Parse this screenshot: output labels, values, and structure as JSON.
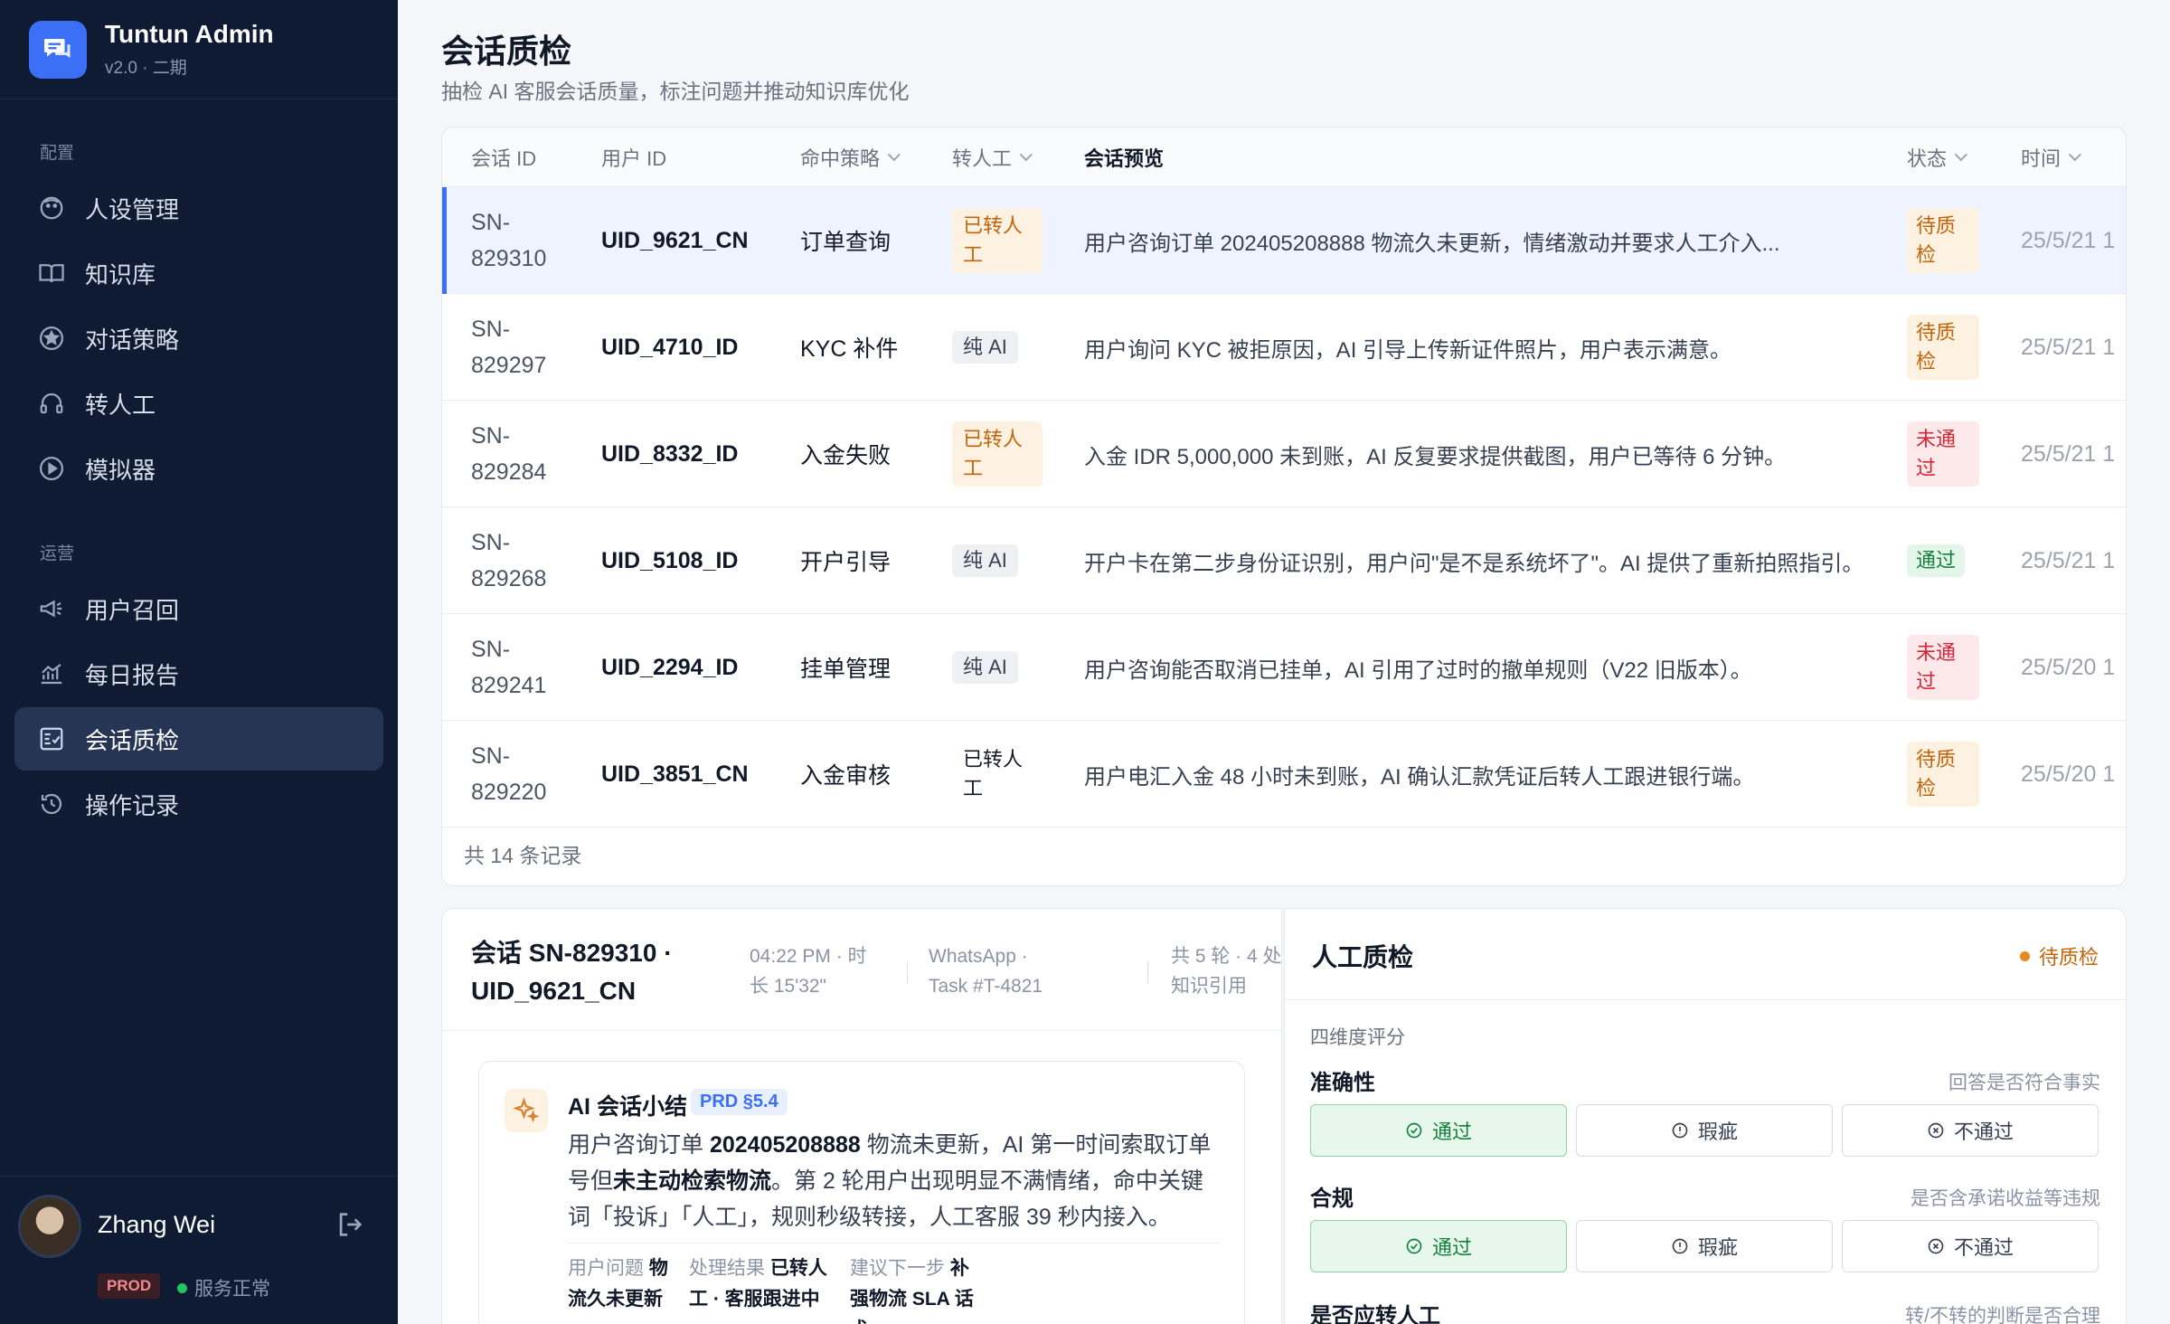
{
  "app": {
    "title": "Tuntun Admin",
    "version": "v2.0 · 二期"
  },
  "sidebar": {
    "section_config": "配置",
    "section_ops": "运营",
    "items": [
      {
        "label": "人设管理",
        "icon": "persona-icon"
      },
      {
        "label": "知识库",
        "icon": "book-icon"
      },
      {
        "label": "对话策略",
        "icon": "star-icon"
      },
      {
        "label": "转人工",
        "icon": "headset-icon"
      },
      {
        "label": "模拟器",
        "icon": "play-icon"
      },
      {
        "label": "用户召回",
        "icon": "megaphone-icon"
      },
      {
        "label": "每日报告",
        "icon": "chart-icon"
      },
      {
        "label": "会话质检",
        "icon": "checklist-icon",
        "active": true
      },
      {
        "label": "操作记录",
        "icon": "history-icon"
      }
    ]
  },
  "user": {
    "name": "Zhang Wei",
    "env": "PROD",
    "status": "服务正常"
  },
  "page": {
    "title": "会话质检",
    "subtitle": "抽检 AI 客服会话质量，标注问题并推动知识库优化"
  },
  "table": {
    "headers": {
      "sn": "会话 ID",
      "uid": "用户 ID",
      "policy": "命中策略",
      "xfer": "转人工",
      "preview": "会话预览",
      "status": "状态",
      "time": "时间"
    },
    "rows": [
      {
        "sn1": "SN-",
        "sn2": "829310",
        "uid": "UID_9621_CN",
        "policy": "订单查询",
        "xfer": "已转人工",
        "preview": "用户咨询订单 202405208888 物流久未更新，情绪激动并要求人工介入...",
        "status": "待质检",
        "time": "25/5/21 1"
      },
      {
        "sn1": "SN-",
        "sn2": "829297",
        "uid": "UID_4710_ID",
        "policy": "KYC 补件",
        "xfer": "纯 AI",
        "preview": "用户询问 KYC 被拒原因，AI 引导上传新证件照片，用户表示满意。",
        "status": "待质检",
        "time": "25/5/21 1"
      },
      {
        "sn1": "SN-",
        "sn2": "829284",
        "uid": "UID_8332_ID",
        "policy": "入金失败",
        "xfer": "已转人工",
        "preview": "入金 IDR 5,000,000 未到账，AI 反复要求提供截图，用户已等待 6 分钟。",
        "status": "未通过",
        "time": "25/5/21 1"
      },
      {
        "sn1": "SN-",
        "sn2": "829268",
        "uid": "UID_5108_ID",
        "policy": "开户引导",
        "xfer": "纯 AI",
        "preview": "开户卡在第二步身份证识别，用户问\"是不是系统坏了\"。AI 提供了重新拍照指引。",
        "status": "通过",
        "time": "25/5/21 1"
      },
      {
        "sn1": "SN-",
        "sn2": "829241",
        "uid": "UID_2294_ID",
        "policy": "挂单管理",
        "xfer": "纯 AI",
        "preview": "用户咨询能否取消已挂单，AI 引用了过时的撤单规则（V22 旧版本）。",
        "status": "未通过",
        "time": "25/5/20 1"
      },
      {
        "sn1": "SN-",
        "sn2": "829220",
        "uid": "UID_3851_CN",
        "policy": "入金审核",
        "xfer": "已转人工",
        "preview": "用户电汇入金 48 小时未到账，AI 确认汇款凭证后转人工跟进银行端。",
        "status": "待质检",
        "time": "25/5/20 1"
      }
    ],
    "footer": "共 14 条记录"
  },
  "detail": {
    "title": "会话 SN-829310 · UID_9621_CN",
    "meta_time": "04:22 PM · 时长 15'32\"",
    "meta_channel": "WhatsApp · Task #T-4821",
    "meta_rounds": "共 5 轮 · 4 处知识引用",
    "summary_title": "AI 会话小结",
    "summary_badge": "PRD §5.4",
    "summary_p1": "用户咨询订单 ",
    "summary_b1": "202405208888",
    "summary_p2": " 物流未更新，AI 第一时间索取订单号但",
    "summary_b2": "未主动检索物流",
    "summary_p3": "。第 2 轮用户出现明显不满情绪，命中关键词「投诉」「人工」，规则秒级转接，人工客服 39 秒内接入。",
    "foot_problem_label": "用户问题",
    "foot_problem": "物流久未更新",
    "foot_result_label": "处理结果",
    "foot_result": "已转人工 · 客服跟进中",
    "foot_next_label": "建议下一步",
    "foot_next": "补强物流 SLA 话术"
  },
  "qa": {
    "title": "人工质检",
    "status": "待质检",
    "section": "四维度评分",
    "options": {
      "pass": "通过",
      "flaw": "瑕疵",
      "fail": "不通过"
    },
    "dims": [
      {
        "label": "准确性",
        "hint": "回答是否符合事实",
        "selected": "pass"
      },
      {
        "label": "合规",
        "hint": "是否含承诺收益等违规",
        "selected": "pass"
      },
      {
        "label": "是否应转人工",
        "hint": "转/不转的判断是否合理"
      }
    ]
  },
  "colors": {
    "accent": "#3b6ff5",
    "sidebar": "#0f1b33",
    "pending": "#c2650a",
    "fail": "#d72638",
    "pass": "#15803d"
  }
}
